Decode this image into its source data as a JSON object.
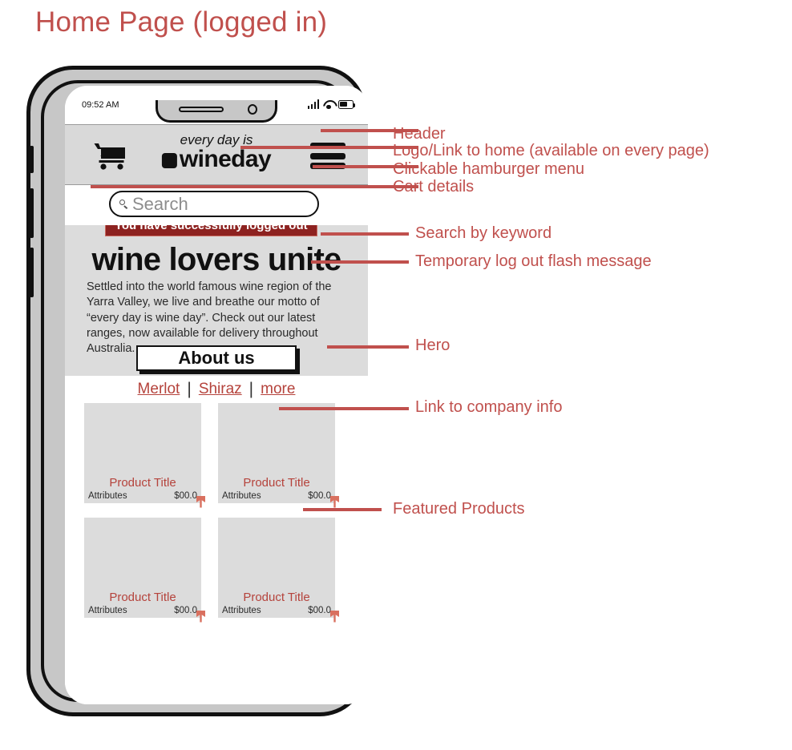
{
  "title": "Home Page (logged in)",
  "phone": {
    "status_bar": {
      "time": "09:52 AM",
      "signal_icon": "signal-bars-icon",
      "wifi_icon": "wifi-icon",
      "battery_icon": "battery-icon"
    }
  },
  "header": {
    "cart_icon": "shopping-cart-icon",
    "logo_tagline": "every day is",
    "logo_word": "wineday",
    "menu_icon": "hamburger-menu-icon"
  },
  "search": {
    "placeholder": "Search",
    "icon": "search-icon"
  },
  "flash": {
    "message": "You have successfully logged out"
  },
  "hero": {
    "heading": "wine lovers unite",
    "body": "Settled into the world famous wine region of the Yarra Valley, we live and breathe our motto of “every day is wine day”. Check out our latest ranges, now available for delivery throughout Australia.",
    "cta": "About us"
  },
  "categories": {
    "items": [
      "Merlot",
      "Shiraz",
      "more"
    ],
    "separator": "|"
  },
  "products": [
    {
      "title": "Product Title",
      "attributes": "Attributes",
      "price": "$00.0"
    },
    {
      "title": "Product Title",
      "attributes": "Attributes",
      "price": "$00.0"
    },
    {
      "title": "Product Title",
      "attributes": "Attributes",
      "price": "$00.0"
    },
    {
      "title": "Product Title",
      "attributes": "Attributes",
      "price": "$00.0"
    }
  ],
  "annotations": [
    {
      "label": "Header"
    },
    {
      "label": "Logo/Link to home (available on every page)"
    },
    {
      "label": "Clickable hamburger menu"
    },
    {
      "label": "Cart details"
    },
    {
      "label": "Search by keyword"
    },
    {
      "label": "Temporary log out flash message"
    },
    {
      "label": "Hero"
    },
    {
      "label": "Link to company info"
    },
    {
      "label": "Featured Products"
    }
  ],
  "colors": {
    "accent": "#c0504d",
    "flash_bg": "#8d2220",
    "link": "#b5433c",
    "panel": "#dcdcdc",
    "header_bg": "#d9d9d9"
  }
}
